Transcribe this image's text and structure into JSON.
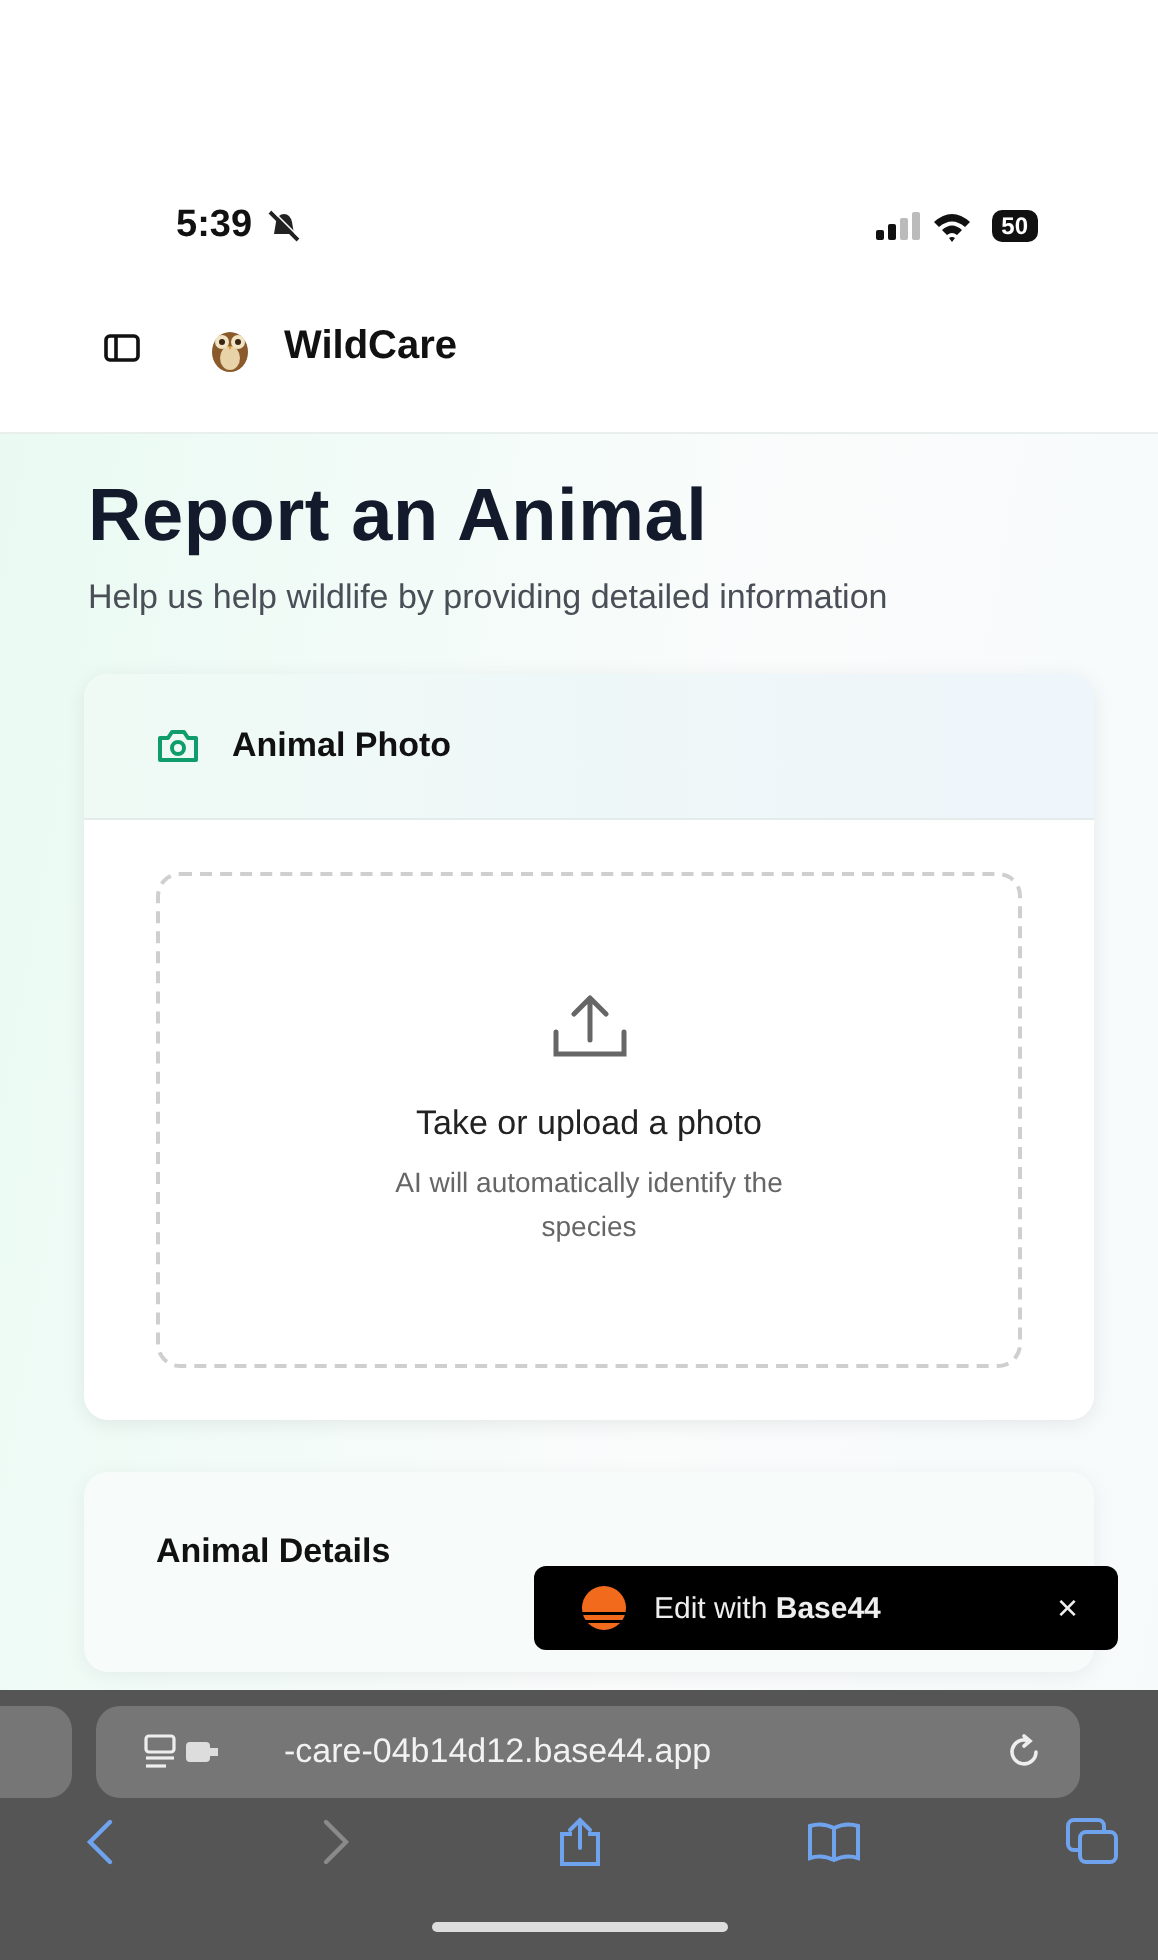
{
  "status_bar": {
    "time": "5:39",
    "battery": "50"
  },
  "header": {
    "app_name": "WildCare"
  },
  "page": {
    "title": "Report an Animal",
    "subtitle": "Help us help wildlife by providing detailed information"
  },
  "photo_card": {
    "title": "Animal Photo",
    "upload_title": "Take or upload a photo",
    "upload_hint": "AI will automatically identify the species"
  },
  "details_card": {
    "title": "Animal Details"
  },
  "badge": {
    "text": "Edit with **Base44**",
    "close": "×"
  },
  "browser": {
    "url": "-care-04b14d12.base44.app",
    "back_disabled": false,
    "forward_disabled": true
  }
}
